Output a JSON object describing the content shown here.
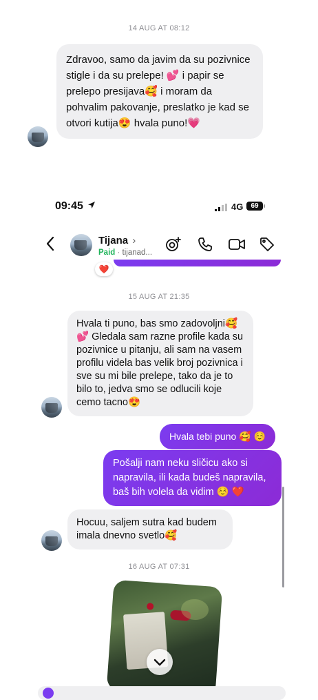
{
  "top_fragment": {
    "timestamp": "14 AUG AT 08:12",
    "message": "Zdravoo, samo da javim da su pozivnice stigle i da su prelepe! 💕 i papir se prelepo presijava🥰 i moram da pohvalim pakovanje, preslatko je kad se otvori kutija😍 hvala puno!💗"
  },
  "status_bar": {
    "time": "09:45",
    "network": "4G",
    "battery": "69"
  },
  "header": {
    "contact_name": "Tijana",
    "chevron": "›",
    "paid_label": "Paid",
    "separator": "·",
    "username": "tijanad...",
    "icons": [
      "add-effect-icon",
      "phone-icon",
      "video-icon",
      "tag-icon"
    ]
  },
  "thread": {
    "reaction": "❤️",
    "messages": [
      {
        "kind": "timestamp",
        "text": "15 AUG AT 21:35"
      },
      {
        "kind": "in",
        "text": "Hvala ti puno, bas smo zadovoljni🥰 💕 Gledala sam razne profile kada su pozivnice u pitanju, ali sam na vasem profilu videla bas velik broj pozivnica i sve su mi bile prelepe, tako da je to bilo to, jedva smo se odlucili koje cemo tacno😍"
      },
      {
        "kind": "out",
        "text": "Hvala tebi puno 🥰 ☺️"
      },
      {
        "kind": "out",
        "text": "Pošalji nam neku sličicu ako si napravila, ili kada budeš napravila, baš bih volela da vidim ☺️ ❤️"
      },
      {
        "kind": "in",
        "text": "Hocuu, saljem sutra kad budem imala dnevno svetlo🥰"
      },
      {
        "kind": "timestamp",
        "text": "16 AUG AT 07:31"
      }
    ]
  },
  "colors": {
    "accent_purple": "#7b3cf0",
    "paid_green": "#1fb45a",
    "incoming_bubble": "#efeff1",
    "timestamp_gray": "#8e8e93"
  }
}
